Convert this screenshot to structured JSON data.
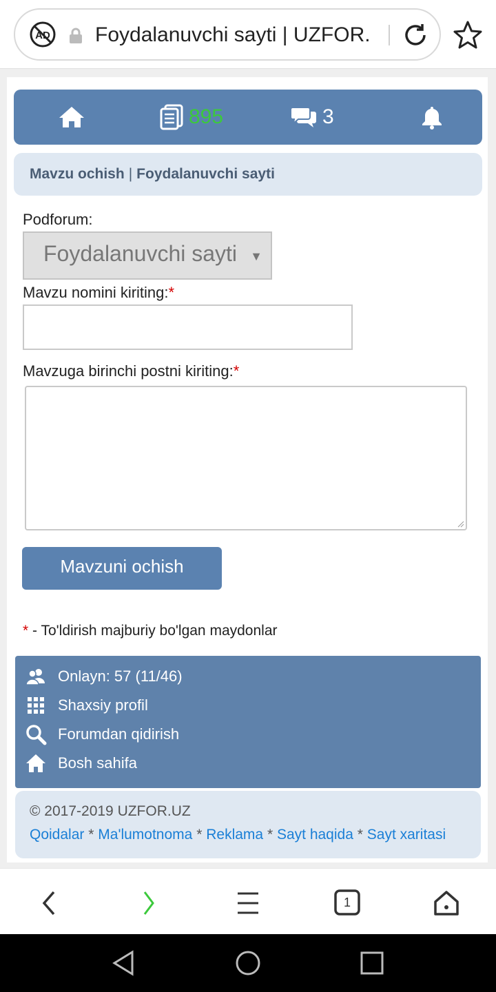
{
  "browser": {
    "url_title": "Foydalanuvchi sayti | UZFOR.",
    "tab_count": "1"
  },
  "nav": {
    "posts_count": "895",
    "messages_count": "3",
    "colors": {
      "bar": "#5b82b0",
      "posts_count": "#3cc93c"
    }
  },
  "breadcrumb": {
    "part1": "Mavzu ochish",
    "separator": "|",
    "part2": "Foydalanuvchi sayti"
  },
  "form": {
    "podforum_label": "Podforum:",
    "podforum_selected": "Foydalanuvchi sayti",
    "title_label": "Mavzu nomini kiriting:",
    "title_value": "",
    "post_label": "Mavzuga birinchi postni kiriting:",
    "post_value": "",
    "required_mark": "*",
    "submit_label": "Mavzuni ochish",
    "required_note": "- To'ldirish majburiy bo'lgan maydonlar"
  },
  "info": {
    "online": "Onlayn: 57 (11/46)",
    "profile": "Shaxsiy profil",
    "search": "Forumdan qidirish",
    "home": "Bosh sahifa"
  },
  "footer": {
    "copyright": "© 2017-2019 UZFOR.UZ",
    "links": [
      "Qoidalar",
      "Ma'lumotnoma",
      "Reklama",
      "Sayt haqida",
      "Sayt xaritasi"
    ],
    "separator": "*"
  }
}
